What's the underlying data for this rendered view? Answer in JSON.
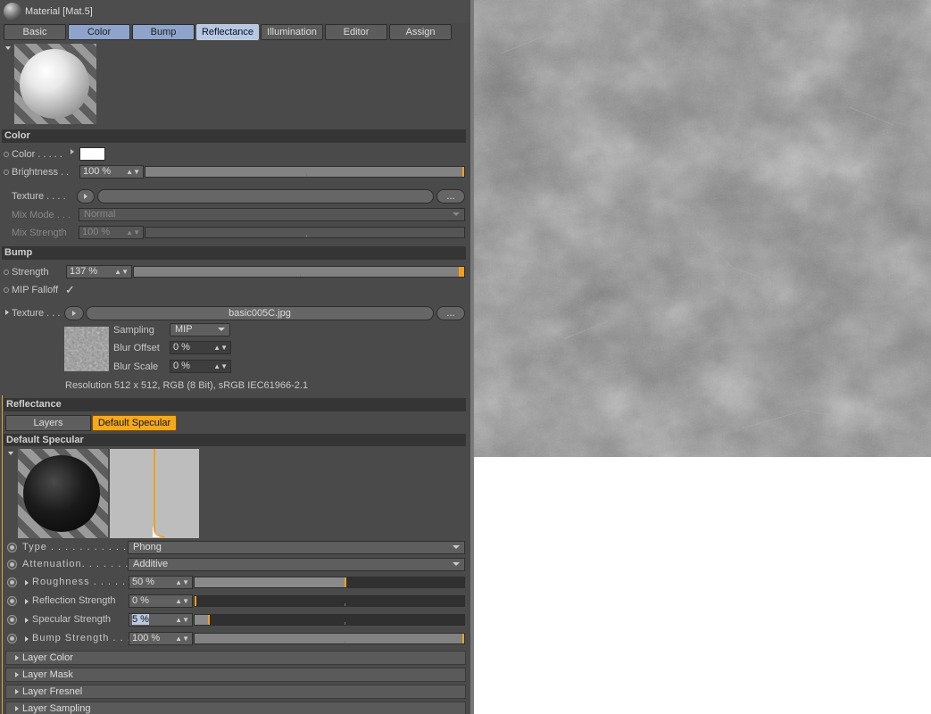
{
  "window": {
    "title": "Material [Mat.5]"
  },
  "tabs": [
    {
      "label": "Basic",
      "style": "plain"
    },
    {
      "label": "Color",
      "style": "blue"
    },
    {
      "label": "Bump",
      "style": "blue"
    },
    {
      "label": "Reflectance",
      "style": "active"
    },
    {
      "label": "Illumination",
      "style": "plain"
    },
    {
      "label": "Editor",
      "style": "plain"
    },
    {
      "label": "Assign",
      "style": "plain"
    }
  ],
  "color": {
    "section": "Color",
    "color_label": "Color . . . . .",
    "color_value": "#ffffff",
    "brightness_label": "Brightness . .",
    "brightness_value": "100 %",
    "brightness_fraction": 1.0,
    "texture_label": "Texture . . . .",
    "texture_button": "...",
    "mixmode_label": "Mix Mode . . .",
    "mixmode_value": "Normal",
    "mixstrength_label": "Mix Strength",
    "mixstrength_value": "100 %"
  },
  "bump": {
    "section": "Bump",
    "strength_label": "Strength",
    "strength_value": "137 %",
    "strength_fraction": 1.0,
    "mip_label": "MIP Falloff",
    "mip_check": "✓",
    "texture_label": "Texture . . .",
    "texture_file": "basic005C.jpg",
    "texture_button": "...",
    "sampling_label": "Sampling",
    "sampling_value": "MIP",
    "bluroffset_label": "Blur Offset",
    "bluroffset_value": "0 %",
    "blurscale_label": "Blur Scale",
    "blurscale_value": "0 %",
    "resolution": "Resolution 512 x 512, RGB (8 Bit), sRGB IEC61966-2.1"
  },
  "reflectance": {
    "section": "Reflectance",
    "layers_tab": "Layers",
    "default_tab": "Default Specular",
    "sub_section": "Default Specular",
    "type_label": "Type . . . . . . . . . . . . . . .",
    "type_value": "Phong",
    "attenuation_label": "Attenuation. . . . . . . . . .",
    "attenuation_value": "Additive",
    "roughness_label": "Roughness . . . . . . .",
    "roughness_value": "50 %",
    "roughness_fraction": 0.56,
    "reflection_label": "Reflection Strength",
    "reflection_value": "0 %",
    "reflection_fraction": 0.0,
    "specular_label": "Specular Strength",
    "specular_value": "5 %",
    "specular_fraction": 0.05,
    "bumpstrength_label": "Bump Strength . . . .",
    "bumpstrength_value": "100 %",
    "bumpstrength_fraction": 1.0,
    "collapsed": [
      "Layer Color",
      "Layer Mask",
      "Layer Fresnel",
      "Layer Sampling"
    ]
  },
  "colors": {
    "accent": "#f0a020",
    "tab_active": "#b4c8e8",
    "tab_blue": "#8ea4cc",
    "panel": "#4a4a4a"
  }
}
